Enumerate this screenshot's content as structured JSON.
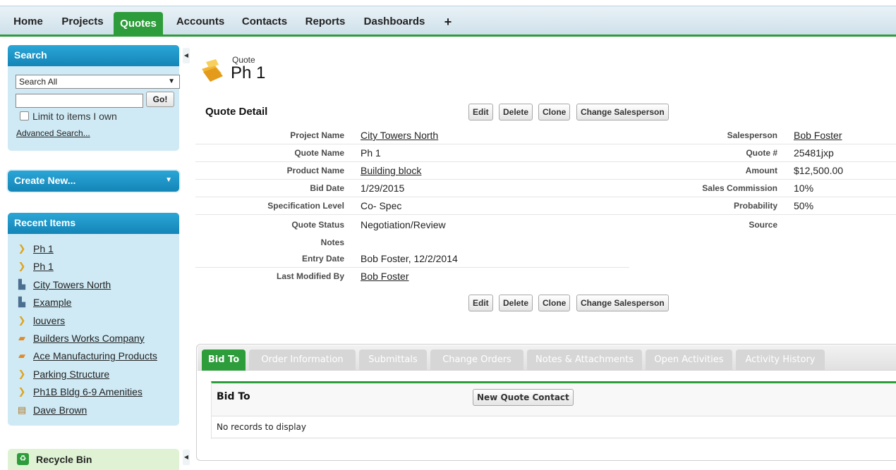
{
  "nav": {
    "tabs": [
      {
        "label": "Home"
      },
      {
        "label": "Projects"
      },
      {
        "label": "Quotes"
      },
      {
        "label": "Accounts"
      },
      {
        "label": "Contacts"
      },
      {
        "label": "Reports"
      },
      {
        "label": "Dashboards"
      },
      {
        "label": "+"
      }
    ],
    "active_tab": "Quotes"
  },
  "sidebar": {
    "search": {
      "title": "Search",
      "scope_value": "Search All",
      "input_value": "",
      "go_label": "Go!",
      "limit_label": "Limit to items I own",
      "limit_checked": false,
      "advanced_label": "Advanced Search..."
    },
    "create_new_label": "Create New...",
    "recent": {
      "title": "Recent Items",
      "items": [
        {
          "label": "Ph 1",
          "icon": "quote-icon"
        },
        {
          "label": "Ph 1",
          "icon": "quote-icon"
        },
        {
          "label": "City Towers North",
          "icon": "project-icon"
        },
        {
          "label": "Example",
          "icon": "project-icon"
        },
        {
          "label": "louvers",
          "icon": "quote-icon"
        },
        {
          "label": "Builders Works Company",
          "icon": "account-icon"
        },
        {
          "label": "Ace Manufacturing Products",
          "icon": "account-icon"
        },
        {
          "label": "Parking Structure",
          "icon": "quote-icon"
        },
        {
          "label": "Ph1B Bldg 6-9 Amenities",
          "icon": "quote-icon"
        },
        {
          "label": "Dave Brown",
          "icon": "contact-icon"
        }
      ]
    },
    "recycle_bin_label": "Recycle Bin"
  },
  "record": {
    "type_label": "Quote",
    "title": "Ph 1"
  },
  "detail": {
    "section_title": "Quote Detail",
    "buttons": {
      "edit": "Edit",
      "delete": "Delete",
      "clone": "Clone",
      "change_salesperson": "Change Salesperson"
    },
    "left_fields": [
      {
        "label": "Project Name",
        "value": "City Towers North",
        "link": true
      },
      {
        "label": "Quote Name",
        "value": "Ph 1",
        "link": false
      },
      {
        "label": "Product Name",
        "value": "Building block",
        "link": true
      },
      {
        "label": "Bid Date",
        "value": "1/29/2015",
        "link": false
      },
      {
        "label": "Specification Level",
        "value": "Co- Spec",
        "link": false
      },
      {
        "label": "Quote Status",
        "value": "Negotiation/Review",
        "link": false
      },
      {
        "label": "Notes",
        "value": "",
        "link": false
      },
      {
        "label": "Entry Date",
        "value": "Bob Foster, 12/2/2014",
        "link": false
      },
      {
        "label": "Last Modified By",
        "value": "Bob Foster",
        "link": true
      }
    ],
    "right_fields": [
      {
        "label": "Salesperson",
        "value": "Bob Foster",
        "link": true
      },
      {
        "label": "Quote #",
        "value": "25481jxp",
        "link": false
      },
      {
        "label": "Amount",
        "value": "$12,500.00",
        "link": false
      },
      {
        "label": "Sales Commission",
        "value": "10%",
        "link": false
      },
      {
        "label": "Probability",
        "value": "50%",
        "link": false
      },
      {
        "label": "Source",
        "value": "",
        "link": false
      }
    ]
  },
  "related": {
    "tabs": [
      {
        "label": "Bid To"
      },
      {
        "label": "Order Information"
      },
      {
        "label": "Submittals"
      },
      {
        "label": "Change Orders"
      },
      {
        "label": "Notes & Attachments"
      },
      {
        "label": "Open Activities"
      },
      {
        "label": "Activity History"
      }
    ],
    "active_tab": "Bid To",
    "bid_to": {
      "title": "Bid To",
      "new_button": "New Quote Contact",
      "empty_message": "No records to display"
    }
  },
  "colors": {
    "accent_green": "#2d9c3a",
    "sidebar_blue": "#1a95c9",
    "sidebar_panel": "#cfeaf5"
  }
}
